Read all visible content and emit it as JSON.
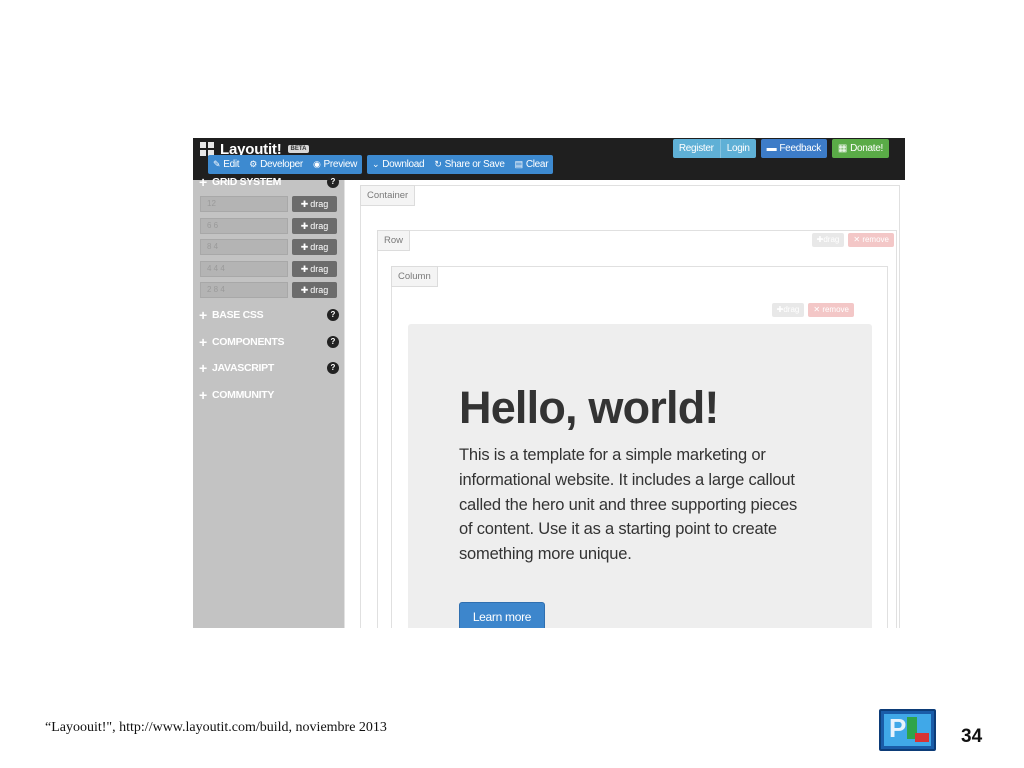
{
  "navbar": {
    "brand": "Layoutit!",
    "beta": "BETA",
    "toolbar": [
      {
        "label": "Edit",
        "icon": "edit-icon"
      },
      {
        "label": "Developer",
        "icon": "developer-icon"
      },
      {
        "label": "Preview",
        "icon": "eye-icon"
      },
      {
        "label": "Download",
        "icon": "chevron-down-icon"
      },
      {
        "label": "Share or Save",
        "icon": "refresh-icon"
      },
      {
        "label": "Clear",
        "icon": "trash-icon"
      }
    ],
    "register": "Register",
    "login": "Login",
    "feedback": "Feedback",
    "donate": "Donate!"
  },
  "sidebar": {
    "grid_title": "GRID SYSTEM",
    "grid_rows": [
      {
        "value": "12",
        "drag": "drag"
      },
      {
        "value": "6 6",
        "drag": "drag"
      },
      {
        "value": "8 4",
        "drag": "drag"
      },
      {
        "value": "4 4 4",
        "drag": "drag"
      },
      {
        "value": "2 8 4",
        "drag": "drag"
      }
    ],
    "sections": [
      "BASE CSS",
      "COMPONENTS",
      "JAVASCRIPT",
      "COMMUNITY"
    ]
  },
  "canvas": {
    "container_label": "Container",
    "row_label": "Row",
    "column_label": "Column",
    "drag": "drag",
    "remove": "remove",
    "hero_title": "Hello, world!",
    "hero_text": "This is a template for a simple marketing or informational website. It includes a large callout called the hero unit and three supporting pieces of content. Use it as a starting point to create something more unique.",
    "learn_more": "Learn more"
  },
  "slide": {
    "caption": "“Layoouit!\", http://www.layoutit.com/build, noviembre 2013",
    "page_number": "34"
  },
  "colors": {
    "navbar_bg": "#1f1f1f",
    "toolbar_blue": "#3d8ad0",
    "sidebar_bg": "#c3c3c3",
    "hero_bg": "#eeeeee",
    "learn_button": "#3d86cc",
    "donate_green": "#5aab47"
  }
}
